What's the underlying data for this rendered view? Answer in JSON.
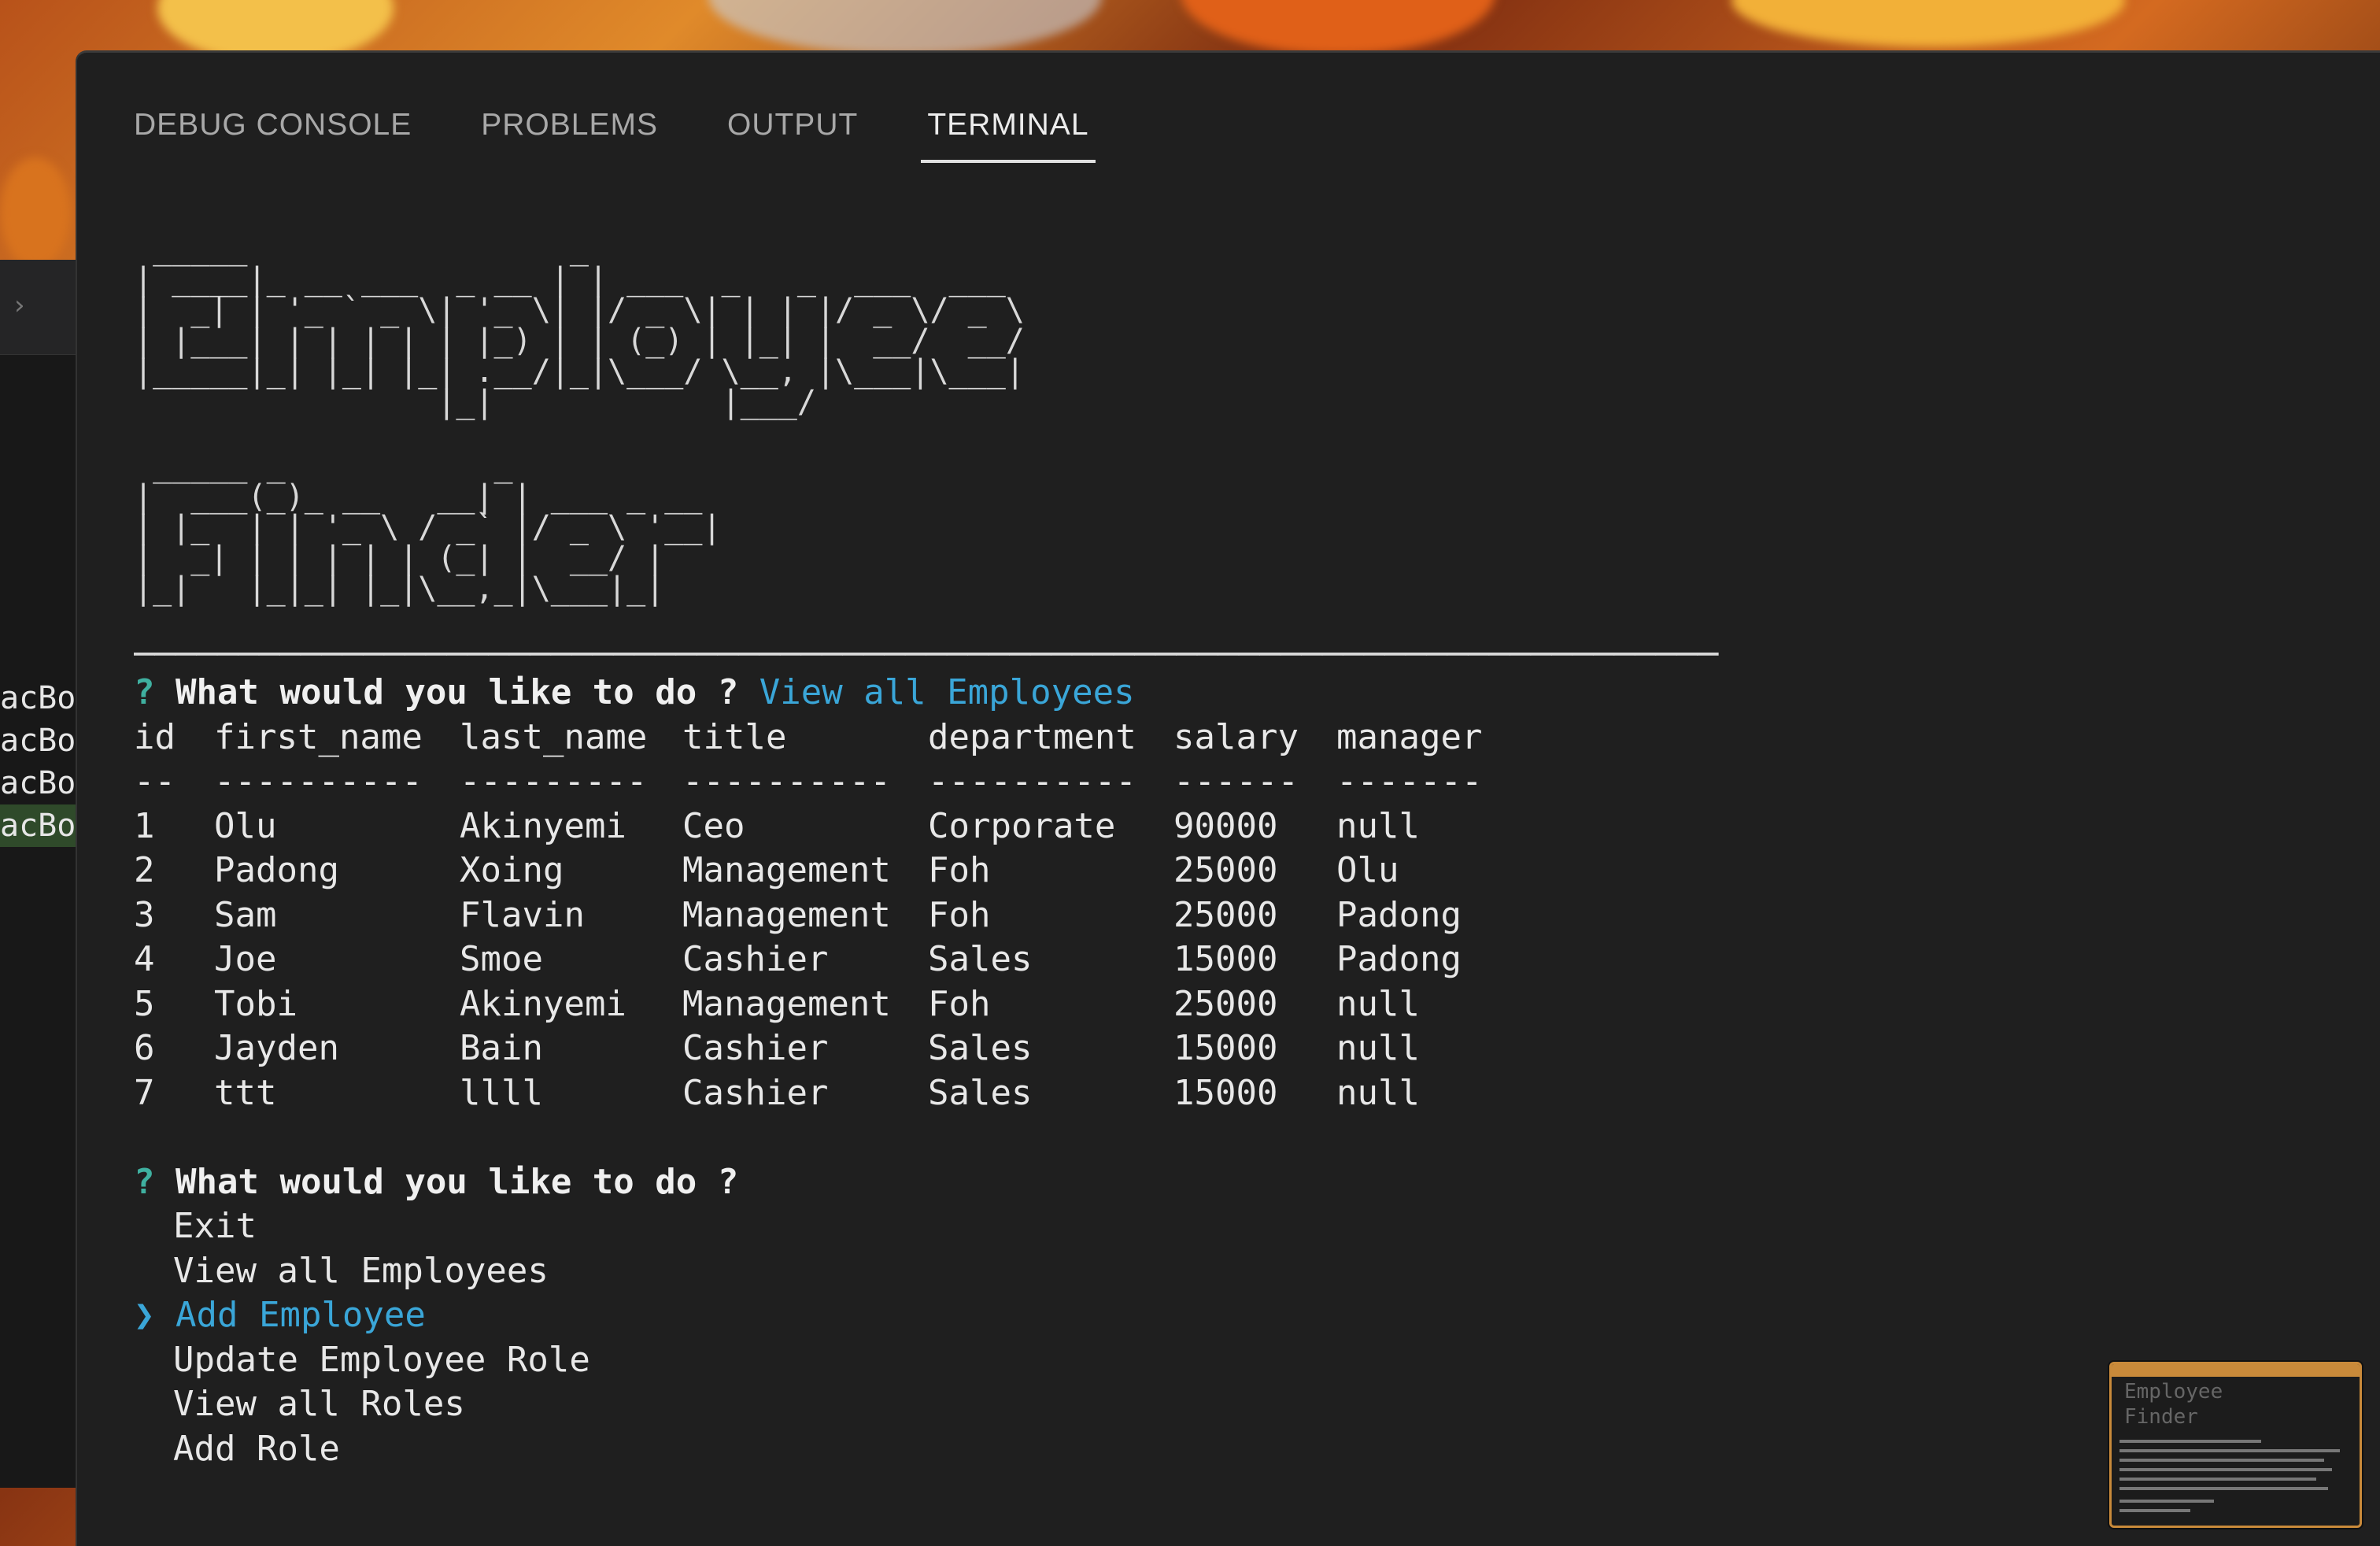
{
  "tabs": [
    {
      "label": "DEBUG CONSOLE",
      "active": false
    },
    {
      "label": "PROBLEMS",
      "active": false
    },
    {
      "label": "OUTPUT",
      "active": false
    },
    {
      "label": "TERMINAL",
      "active": true
    }
  ],
  "left_editor": {
    "lines": [
      "acBo",
      "acBo",
      "acBo",
      "acBo"
    ],
    "chevron": "›"
  },
  "banner": {
    "employee_art": " _____                 _                       \n| ____|_ __ ___  _ __ | | ___  _   _  ___  ___ \n|  _| | '_ ` _ \\| '_ \\| |/ _ \\| | | |/ _ \\/ _ \\\n| |___| | | | | | |_) | | (_) | |_| |  __/  __/\n|_____|_| |_| |_| .__/|_|\\___/ \\__, |\\___|\\___|\n                |_|            |___/           ",
    "finder_art": " _____ _           _           \n|  ___(_)_ __   __| | ___ _ __ \n| |_  | | '_ \\ / _` |/ _ \\ '__|\n|  _| | | | | | (_| |  __/ |   \n|_|   |_|_| |_|\\__,_|\\___|_|   ",
    "rule": "────────────────────────────────────────────────────────────────────────────"
  },
  "first_prompt": {
    "mark": "?",
    "question": "What would you like to do ?",
    "answer": "View all Employees"
  },
  "table": {
    "headers": [
      "id",
      "first_name",
      "last_name",
      "title",
      "department",
      "salary",
      "manager"
    ],
    "underlines": [
      "--",
      "----------",
      "---------",
      "----------",
      "----------",
      "------",
      "-------"
    ],
    "rows": [
      [
        "1",
        "Olu",
        "Akinyemi",
        "Ceo",
        "Corporate",
        "90000",
        "null"
      ],
      [
        "2",
        "Padong",
        "Xoing",
        "Management",
        "Foh",
        "25000",
        "Olu"
      ],
      [
        "3",
        "Sam",
        "Flavin",
        "Management",
        "Foh",
        "25000",
        "Padong"
      ],
      [
        "4",
        "Joe",
        "Smoe",
        "Cashier",
        "Sales",
        "15000",
        "Padong"
      ],
      [
        "5",
        "Tobi",
        "Akinyemi",
        "Management",
        "Foh",
        "25000",
        "null"
      ],
      [
        "6",
        "Jayden",
        "Bain",
        "Cashier",
        "Sales",
        "15000",
        "null"
      ],
      [
        "7",
        "ttt",
        "llll",
        "Cashier",
        "Sales",
        "15000",
        "null"
      ]
    ]
  },
  "second_prompt": {
    "mark": "?",
    "question": "What would you like to do ?",
    "selector": "❯",
    "options": [
      "Exit",
      "View all Employees",
      "Add Employee",
      "Update Employee Role",
      "View all Roles",
      "Add Role"
    ],
    "selected_index": 2
  },
  "thumbnail": {
    "line1": "Employee",
    "line2": "Finder"
  },
  "colors": {
    "terminal_bg": "#1f1f1f",
    "answer_blue": "#3aa6d8",
    "prompt_green": "#3fb0a0",
    "active_line": "#2f4a2a"
  }
}
